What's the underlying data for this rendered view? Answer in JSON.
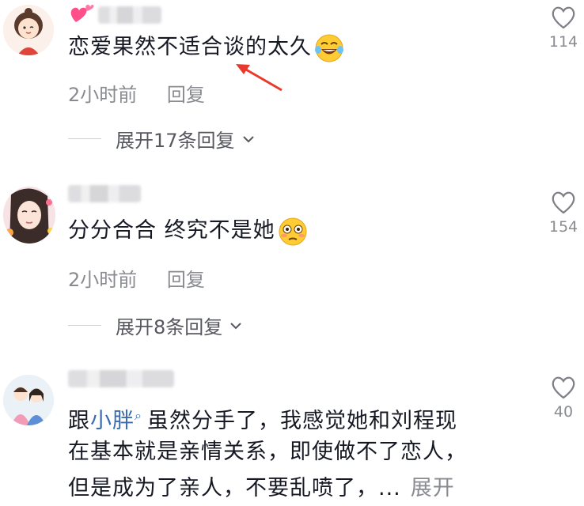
{
  "comments": [
    {
      "text": "恋爱果然不适合谈的太久",
      "time": "2小时前",
      "reply": "回复",
      "expand": "展开17条回复",
      "likes": "114"
    },
    {
      "text": "分分合合 终究不是她",
      "time": "2小时前",
      "reply": "回复",
      "expand": "展开8条回复",
      "likes": "154"
    },
    {
      "line1_prefix": "跟",
      "mention": "小胖",
      "line1_suffix": "虽然分手了，我感觉她和刘程现",
      "line2": "在基本就是亲情关系，即使做不了恋人，",
      "line3": "但是成为了亲人，不要乱喷了，...",
      "more": "展开",
      "likes": "40"
    }
  ],
  "icons": {
    "heart": "heart-outline-icon",
    "chevron": "chevron-down-icon"
  },
  "colors": {
    "text": "#161823",
    "meta": "#8a8b91",
    "mention": "#3a6bb0",
    "arrow": "#e8392c"
  }
}
